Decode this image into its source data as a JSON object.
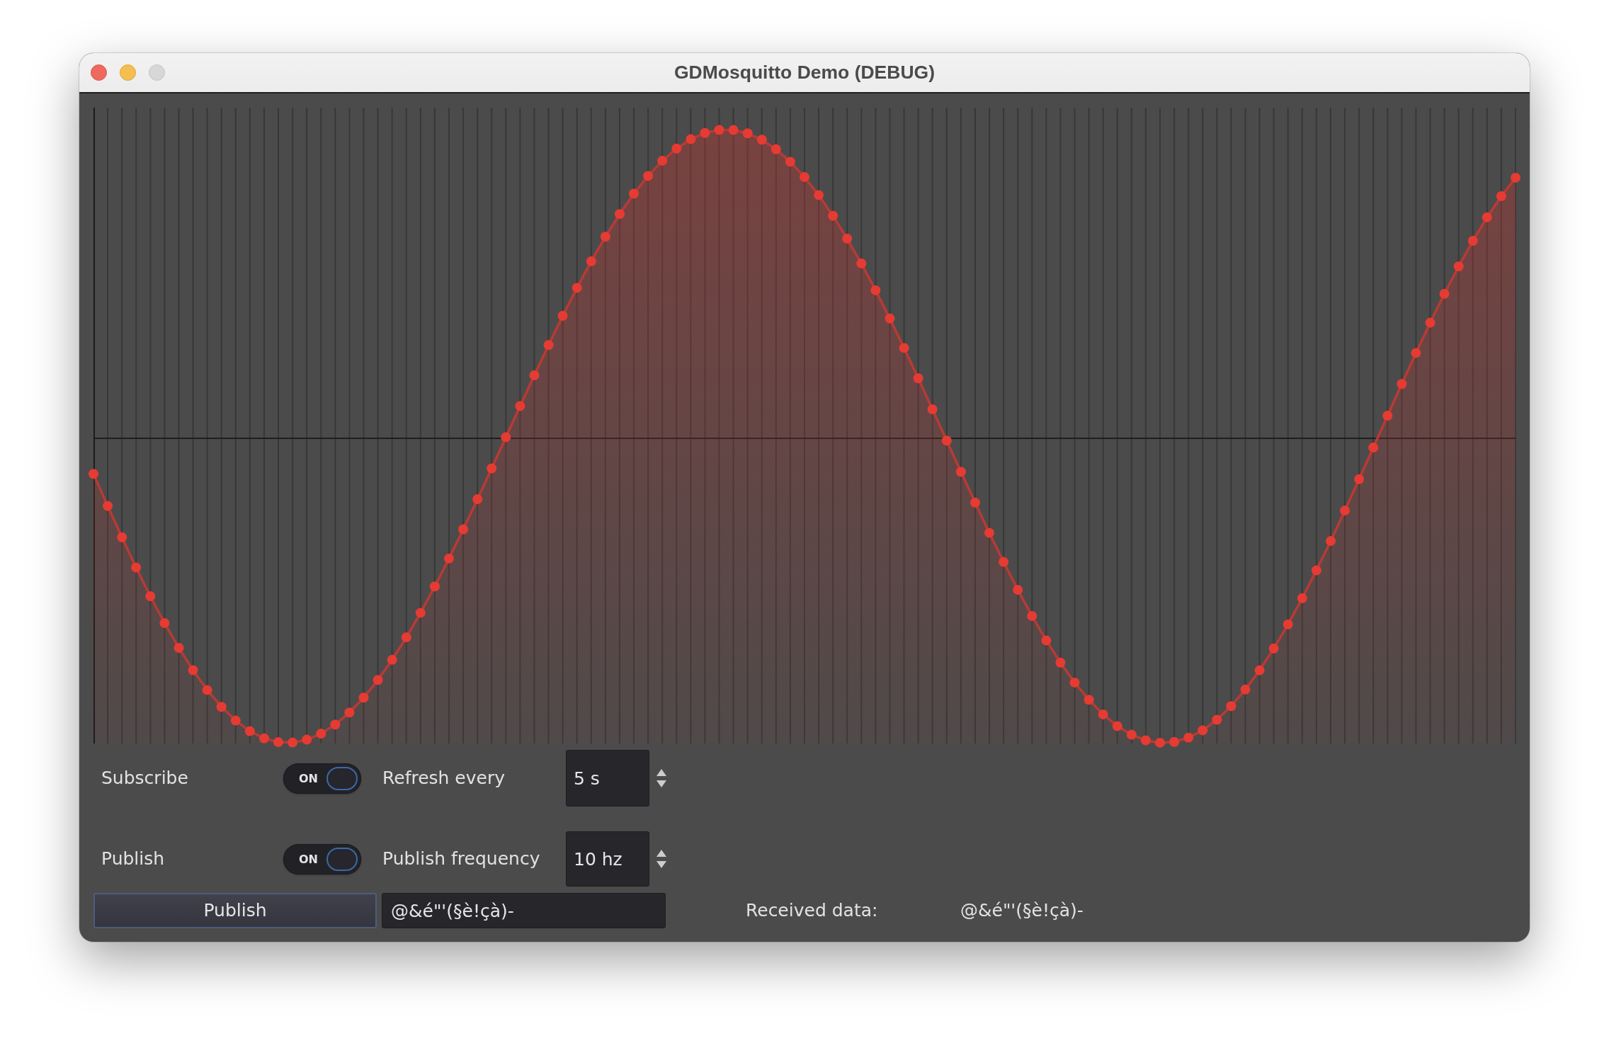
{
  "window": {
    "title": "GDMosquitto Demo (DEBUG)",
    "buttons": [
      {
        "kind": "close",
        "disabled": false
      },
      {
        "kind": "minimize",
        "disabled": false
      },
      {
        "kind": "zoom",
        "disabled": true
      }
    ]
  },
  "controls": [
    {
      "label": "Subscribe",
      "toggle": {
        "on": true,
        "text": "ON"
      },
      "setting_label": "Refresh every",
      "spinbox": {
        "value": "5 s"
      }
    },
    {
      "label": "Publish",
      "toggle": {
        "on": true,
        "text": "ON"
      },
      "setting_label": "Publish frequency",
      "spinbox": {
        "value": "10 hz"
      }
    }
  ],
  "publish_button": {
    "label": "Publish"
  },
  "message_field": {
    "value": "@&é\"'(§è!çà)-"
  },
  "received": {
    "label": "Received data:",
    "value": "@&é\"'(§è!çà)-"
  }
}
